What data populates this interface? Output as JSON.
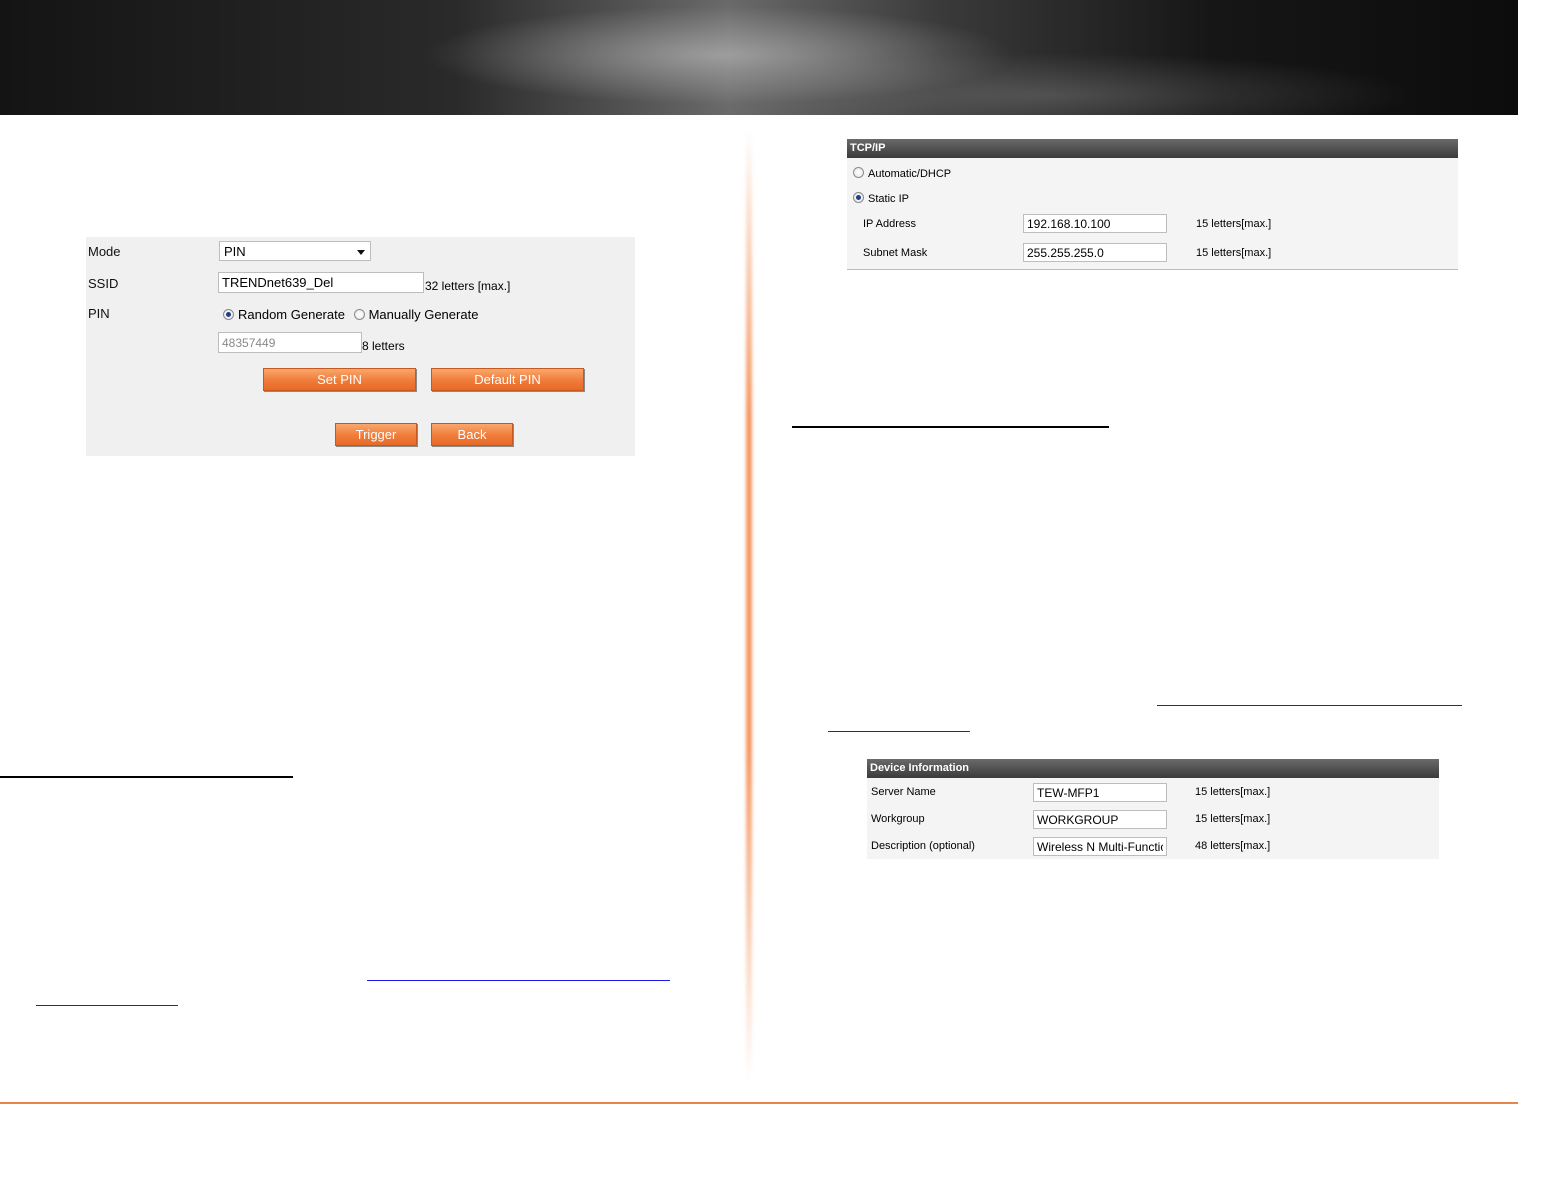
{
  "wps": {
    "mode_label": "Mode",
    "mode_value": "PIN",
    "ssid_label": "SSID",
    "ssid_value": "TRENDnet639_Del",
    "ssid_hint": "32 letters [max.]",
    "pin_label": "PIN",
    "radio_random": "Random Generate",
    "radio_manual": "Manually Generate",
    "pin_value": "48357449",
    "pin_hint": "8 letters",
    "set_pin_button": "Set PIN",
    "default_pin_button": "Default PIN",
    "trigger_button": "Trigger",
    "back_button": "Back"
  },
  "tcpip": {
    "header": "TCP/IP",
    "option_dhcp": "Automatic/DHCP",
    "option_static": "Static IP",
    "ip_label": "IP Address",
    "ip_value": "192.168.10.100",
    "ip_hint": "15 letters[max.]",
    "mask_label": "Subnet Mask",
    "mask_value": "255.255.255.0",
    "mask_hint": "15 letters[max.]"
  },
  "device_info": {
    "header": "Device Information",
    "server_label": "Server Name",
    "server_value": "TEW-MFP1",
    "server_hint": "15 letters[max.]",
    "workgroup_label": "Workgroup",
    "workgroup_value": "WORKGROUP",
    "workgroup_hint": "15 letters[max.]",
    "description_label": "Description (optional)",
    "description_value": "Wireless N Multi-Function",
    "description_hint": "48 letters[max.]"
  },
  "colors": {
    "accent_orange": "#f07c3a",
    "footer_line": "#e8834a",
    "link_blue": "#1a1aee"
  }
}
